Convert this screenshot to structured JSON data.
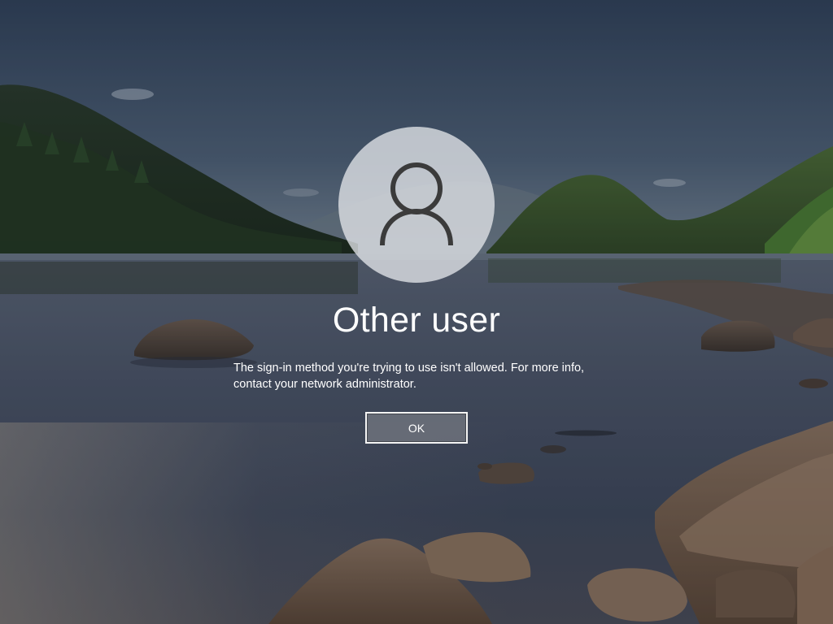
{
  "lock_screen": {
    "user_name": "Other user",
    "message": "The sign-in method you're trying to use isn't allowed. For more info, contact your network administrator.",
    "ok_label": "OK",
    "avatar_icon": "person-icon"
  },
  "colors": {
    "sky_top": "#33455f",
    "sky_bottom": "#6e7f92",
    "water": "#4a5468",
    "button_border": "#f4f4f4",
    "text": "#ffffff"
  }
}
